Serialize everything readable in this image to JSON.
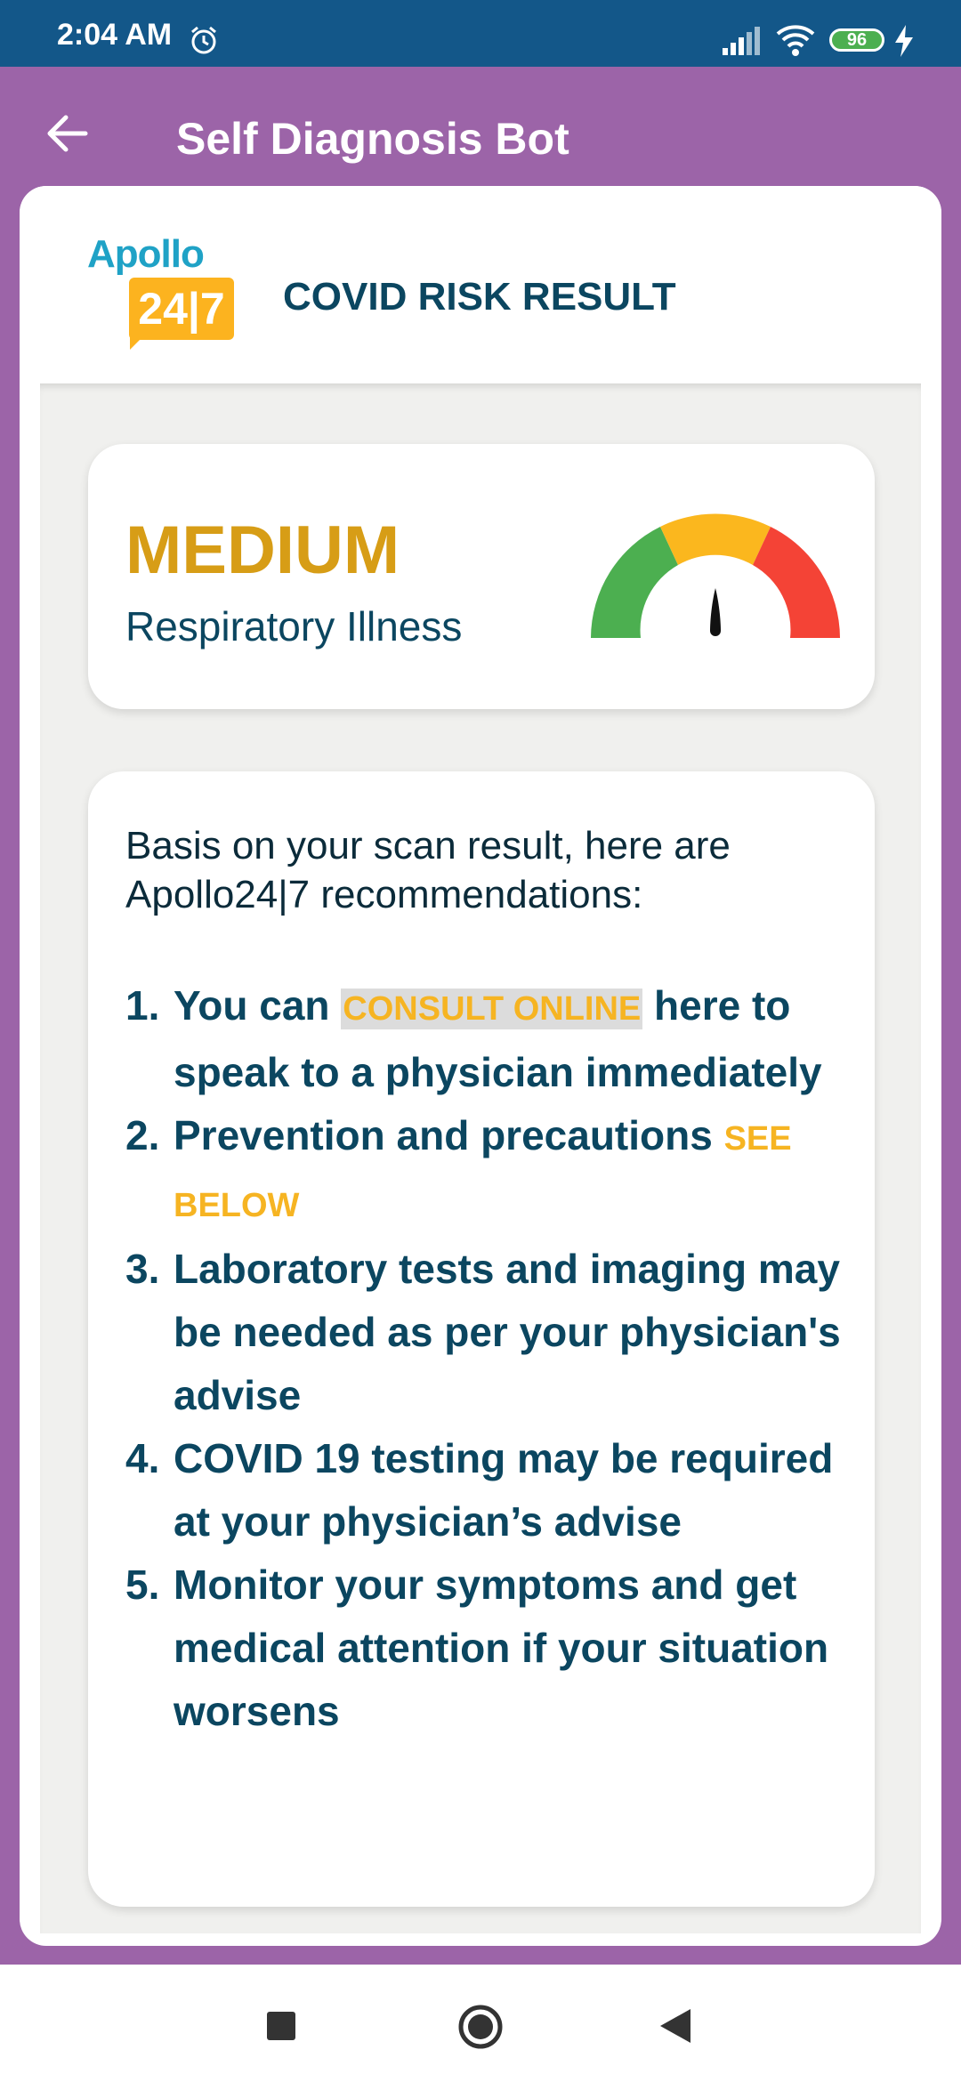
{
  "status_bar": {
    "time": "2:04 AM",
    "battery": "96",
    "icons": [
      "alarm-icon",
      "signal-icon",
      "wifi-icon",
      "battery-icon",
      "charging-bolt-icon"
    ]
  },
  "app_bar": {
    "title": "Self Diagnosis Bot",
    "back_icon": "arrow-left-icon"
  },
  "header": {
    "logo_text": "Apollo",
    "logo_badge": "24|7",
    "title": "COVID RISK RESULT"
  },
  "risk": {
    "level": "MEDIUM",
    "type": "Respiratory Illness",
    "gauge_colors": [
      "#4caf50",
      "#fbb71e",
      "#f44336"
    ]
  },
  "recommendations": {
    "intro": "Basis on your scan result, here are Apollo24|7 recommendations:",
    "items": [
      {
        "num": "1.",
        "pre": "You can ",
        "link": "CONSULT ONLINE",
        "post": " here to speak to a physician immediately"
      },
      {
        "num": "2.",
        "pre": "Prevention and precautions ",
        "link": "SEE BELOW",
        "post": ""
      },
      {
        "num": "3.",
        "text": "Laboratory tests and imaging may be needed as per your physician's advise"
      },
      {
        "num": "4.",
        "text": "COVID 19 testing may be required at your physician’s advise"
      },
      {
        "num": "5.",
        "text": "Monitor your symptoms and get medical attention if your situation worsens"
      }
    ]
  },
  "colors": {
    "status_bar": "#135789",
    "app_bar": "#9c64a8",
    "accent": "#f6b422",
    "primary_text": "#0b4660",
    "medium": "#d79d16"
  },
  "nav_bar": {
    "icons": [
      "recents-square-icon",
      "home-circle-icon",
      "back-triangle-icon"
    ]
  }
}
